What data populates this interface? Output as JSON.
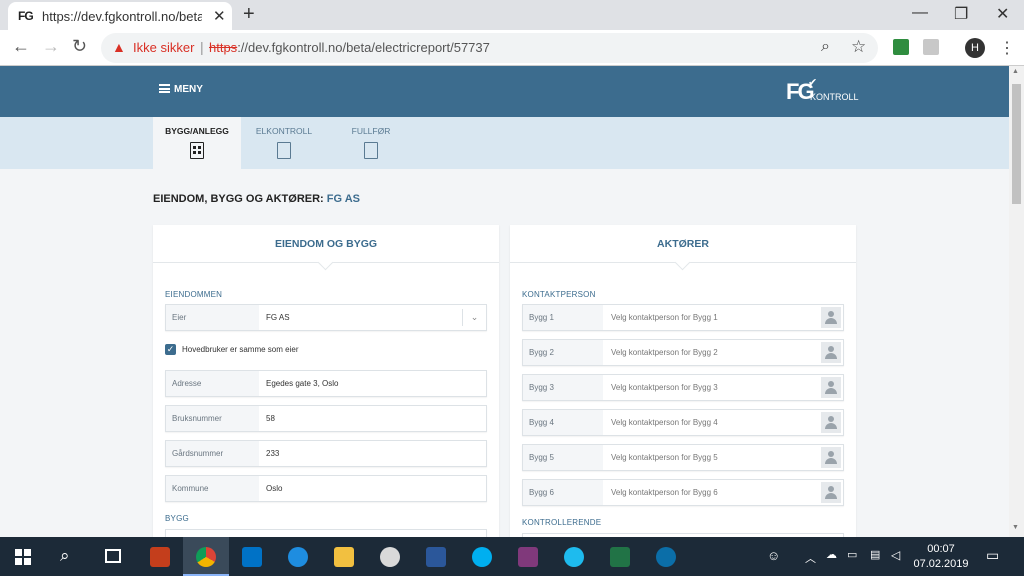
{
  "browser": {
    "tab_title": "https://dev.fgkontroll.no/beta/ele",
    "tab_favicon": "FG",
    "insecure_label": "Ikke sikker",
    "url_scheme": "https",
    "url_rest": "://dev.fgkontroll.no/beta/electricreport/57737",
    "profile_initial": "H"
  },
  "app": {
    "menu_label": "MENY",
    "logo_main": "FG",
    "logo_sub": "KONTROLL",
    "steps": [
      {
        "label": "BYGG/ANLEGG",
        "active": true
      },
      {
        "label": "ELKONTROLL",
        "active": false
      },
      {
        "label": "FULLFØR",
        "active": false
      }
    ],
    "section_title": "EIENDOM, BYGG OG AKTØRER:",
    "section_company": "FG AS",
    "left_card": {
      "title": "EIENDOM OG BYGG",
      "group1": "EIENDOMMEN",
      "owner_label": "Eier",
      "owner_value": "FG AS",
      "checkbox_label": "Hovedbruker er samme som eier",
      "checkbox_checked": true,
      "fields": [
        {
          "label": "Adresse",
          "value": "Egedes gate 3, Oslo"
        },
        {
          "label": "Bruksnummer",
          "value": "58"
        },
        {
          "label": "Gårdsnummer",
          "value": "233"
        },
        {
          "label": "Kommune",
          "value": "Oslo"
        }
      ],
      "group2": "BYGG"
    },
    "right_card": {
      "title": "AKTØRER",
      "group1": "KONTAKTPERSON",
      "contacts": [
        {
          "label": "Bygg 1",
          "placeholder": "Velg kontaktperson for Bygg 1"
        },
        {
          "label": "Bygg 2",
          "placeholder": "Velg kontaktperson for Bygg 2"
        },
        {
          "label": "Bygg 3",
          "placeholder": "Velg kontaktperson for Bygg 3"
        },
        {
          "label": "Bygg 4",
          "placeholder": "Velg kontaktperson for Bygg 4"
        },
        {
          "label": "Bygg 5",
          "placeholder": "Velg kontaktperson for Bygg 5"
        },
        {
          "label": "Bygg 6",
          "placeholder": "Velg kontaktperson for Bygg 6"
        }
      ],
      "group2": "KONTROLLERENDE"
    }
  },
  "taskbar": {
    "time": "00:07",
    "date": "07.02.2019"
  },
  "colors": {
    "header": "#3c6c8e",
    "stepbar": "#d9e7f1",
    "accent": "#3c6c8e",
    "insecure": "#d93025",
    "taskbar": "#1c2a38"
  }
}
